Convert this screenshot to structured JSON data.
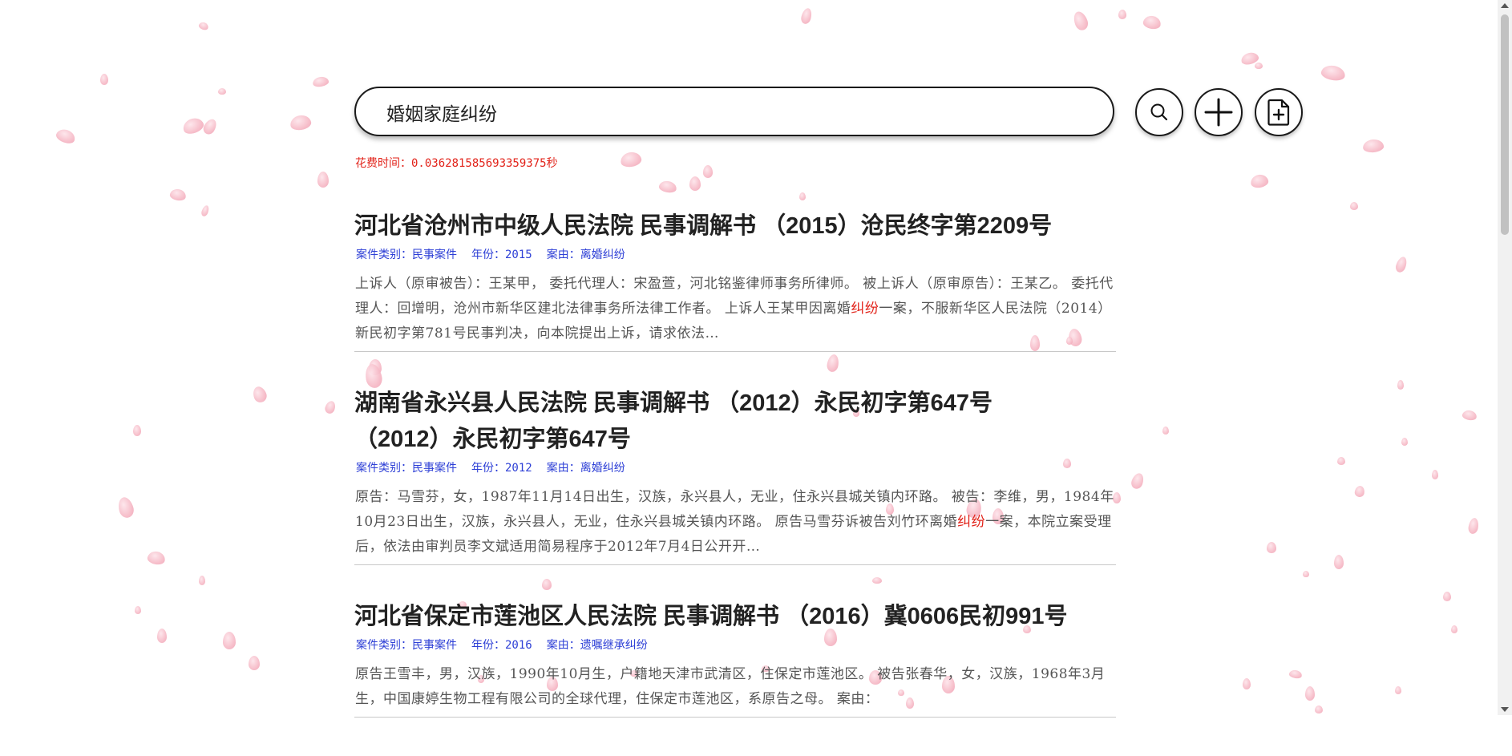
{
  "search": {
    "query": "婚姻家庭纠纷"
  },
  "elapsed_time": "花费时间：0.036281585693359375秒",
  "results": [
    {
      "title": "河北省沧州市中级人民法院 民事调解书 （2015）沧民终字第2209号",
      "case_type": "案件类别：民事案件",
      "year": "年份：2015",
      "cause": "案由：离婚纠纷",
      "snippet_before": "上诉人（原审被告）：王某甲， 委托代理人：宋盈萱，河北铭鉴律师事务所律师。 被上诉人（原审原告）：王某乙。 委托代理人：回增明，沧州市新华区建北法律事务所法律工作者。 上诉人王某甲因离婚",
      "snippet_highlight": "纠纷",
      "snippet_after": "一案，不服新华区人民法院（2014）新民初字第781号民事判决，向本院提出上诉，请求依法…"
    },
    {
      "title": "湖南省永兴县人民法院 民事调解书 （2012）永民初字第647号 （2012）永民初字第647号",
      "case_type": "案件类别：民事案件",
      "year": "年份：2012",
      "cause": "案由：离婚纠纷",
      "snippet_before": "原告：马雪芬，女，1987年11月14日出生，汉族，永兴县人，无业，住永兴县城关镇内环路。 被告：李维，男，1984年10月23日出生，汉族，永兴县人，无业，住永兴县城关镇内环路。 原告马雪芬诉被告刘竹环离婚",
      "snippet_highlight": "纠纷",
      "snippet_after": "一案，本院立案受理后，依法由审判员李文斌适用简易程序于2012年7月4日公开开…"
    },
    {
      "title": "河北省保定市莲池区人民法院 民事调解书 （2016）冀0606民初991号",
      "case_type": "案件类别：民事案件",
      "year": "年份：2016",
      "cause": "案由：遗嘱继承纠纷",
      "snippet_before": "原告王雪丰，男，汉族，1990年10月生，户籍地天津市武清区，住保定市莲池区。 被告张春华，女，汉族，1968年3月生，中国康婷生物工程有限公司的全球代理，住保定市莲池区，系原告之母。 案由：",
      "snippet_highlight": "",
      "snippet_after": ""
    }
  ],
  "icons": {
    "search": "search-icon",
    "add": "plus-icon",
    "file": "file-add-icon"
  },
  "colors": {
    "highlight": "#e2231a",
    "meta": "#2d3fd6",
    "petal": "#f6b9c6"
  }
}
